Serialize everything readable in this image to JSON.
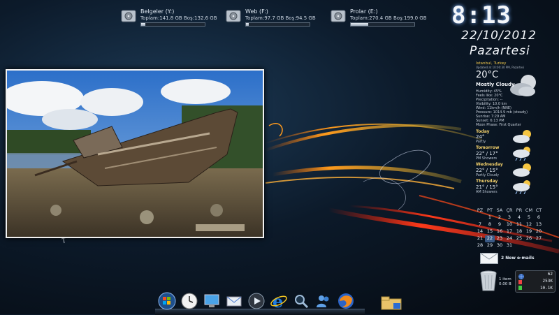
{
  "drives": [
    {
      "name": "Belgeler (Y:)",
      "stats": "Toplam:141.8 GB  Boş:132.6 GB",
      "used_fraction": 0.07
    },
    {
      "name": "Web (F:)",
      "stats": "Toplam:97.7 GB  Boş:94.5 GB",
      "used_fraction": 0.04
    },
    {
      "name": "Prolar (E:)",
      "stats": "Toplam:270.4 GB  Boş:199.0 GB",
      "used_fraction": 0.27
    }
  ],
  "clock": {
    "time": "8:13",
    "date": "22/10/2012",
    "day": "Pazartesi"
  },
  "weather": {
    "location": "Istanbul, Turkey",
    "updated": "Updated at 10:00:30 PM, Pazartesi",
    "temperature": "20°C",
    "condition": "Mostly Cloudy",
    "details": [
      "Humidity: 45%",
      "Feels like: 20°C",
      "Precipitation: --",
      "Visibility: 10.0 km",
      "Wind: 11km/h (NNE)",
      "Pressure: 1014.9 mb (steady)",
      "Sunrise: 7:29 AM",
      "Sunset: 6:13 PM",
      "Moon Phase: First Quarter"
    ],
    "forecast": [
      {
        "day": "Today",
        "temp": "24°",
        "cond": "Partly"
      },
      {
        "day": "Tomorrow",
        "temp": "22° / 17°",
        "cond": "PM Showers"
      },
      {
        "day": "Wednesday",
        "temp": "22° / 15°",
        "cond": "Partly Cloudy"
      },
      {
        "day": "Thursday",
        "temp": "21° / 15°",
        "cond": "AM Showers"
      }
    ]
  },
  "calendar": {
    "headers": [
      "PZ",
      "PT",
      "SA",
      "ÇR",
      "PR",
      "CM",
      "CT"
    ],
    "weeks": [
      [
        "",
        "1",
        "2",
        "3",
        "4",
        "5",
        "6"
      ],
      [
        "7",
        "8",
        "9",
        "10",
        "11",
        "12",
        "13"
      ],
      [
        "14",
        "15",
        "16",
        "17",
        "18",
        "19",
        "20"
      ],
      [
        "21",
        "22",
        "23",
        "24",
        "25",
        "26",
        "27"
      ],
      [
        "28",
        "29",
        "30",
        "31",
        "",
        "",
        ""
      ]
    ],
    "today": "22"
  },
  "email": {
    "label": "2 New e-mails"
  },
  "recycle_bin": {
    "items": "1 item",
    "size": "0.00 B"
  },
  "network": {
    "v1": "62",
    "v2": "253K",
    "v3": "10.1K"
  },
  "dock_icons": [
    "start-orb-icon",
    "clock-icon",
    "computer-icon",
    "mail-icon",
    "media-player-icon",
    "ie-icon",
    "search-icon",
    "users-icon",
    "firefox-icon"
  ],
  "colors": {
    "accent": "#f2c94c",
    "streak_orange": "#ff8a1a",
    "streak_red": "#ff2a1a"
  }
}
